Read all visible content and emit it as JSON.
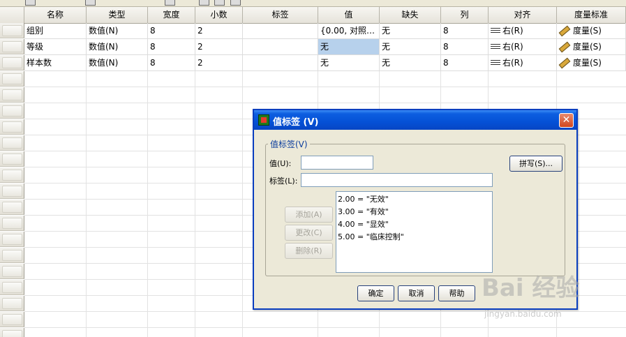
{
  "columns": [
    "名称",
    "类型",
    "宽度",
    "小数",
    "标签",
    "值",
    "缺失",
    "列",
    "对齐",
    "度量标准"
  ],
  "rows": [
    {
      "name": "组别",
      "type": "数值(N)",
      "width": "8",
      "decimals": "2",
      "label": "",
      "values": "{0.00, 对照…",
      "missing": "无",
      "columns": "8",
      "align": "右(R)",
      "measure": "度量(S)"
    },
    {
      "name": "等级",
      "type": "数值(N)",
      "width": "8",
      "decimals": "2",
      "label": "",
      "values": "无",
      "missing": "无",
      "columns": "8",
      "align": "右(R)",
      "measure": "度量(S)"
    },
    {
      "name": "样本数",
      "type": "数值(N)",
      "width": "8",
      "decimals": "2",
      "label": "",
      "values": "无",
      "missing": "无",
      "columns": "8",
      "align": "右(R)",
      "measure": "度量(S)"
    }
  ],
  "dialog": {
    "title": "值标签 (V)",
    "close": "✕",
    "group_legend": "值标签(V)",
    "value_label": "值(U):",
    "value_input": "",
    "label_label": "标签(L):",
    "label_input": "",
    "spell_button": "拼写(S)...",
    "add_button": "添加(A)",
    "change_button": "更改(C)",
    "remove_button": "删除(R)",
    "list_items": [
      "2.00 = \"无效\"",
      "3.00 = \"有效\"",
      "4.00 = \"显效\"",
      "5.00 = \"临床控制\""
    ],
    "ok_button": "确定",
    "cancel_button": "取消",
    "help_button": "帮助"
  },
  "watermark": {
    "main": "Bai 经验",
    "sub": "jingyan.baidu.com"
  },
  "colors": {
    "selected_cell": "#b7d1ec",
    "titlebar": "#0551d6",
    "dialog_bg": "#ece9d8"
  }
}
